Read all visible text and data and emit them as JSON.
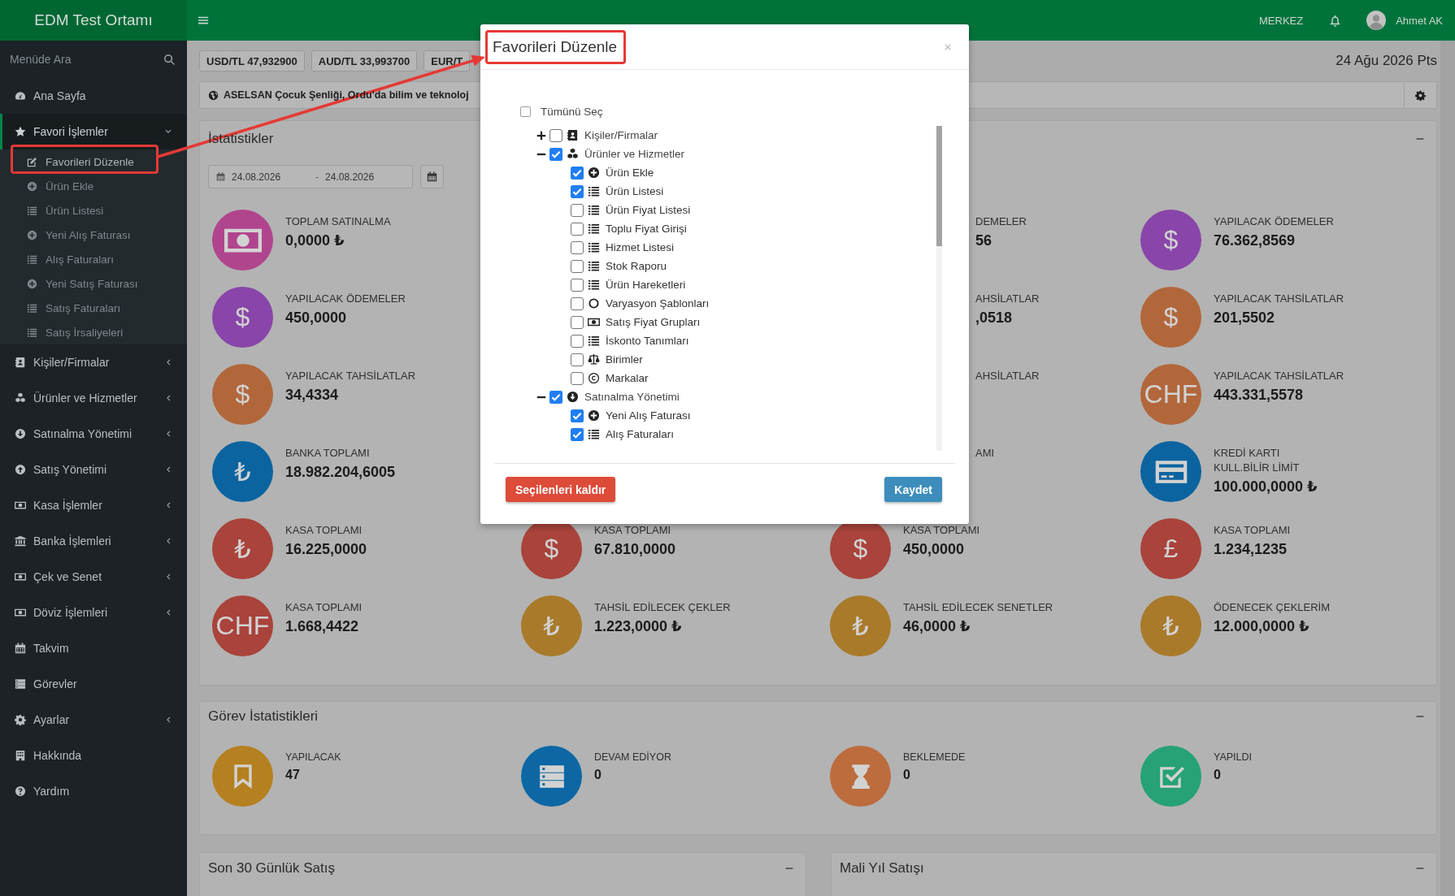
{
  "topbar": {
    "branch": "MERKEZ",
    "user": "Ahmet AK"
  },
  "sidebar": {
    "brand": "EDM Test Ortamı",
    "search": {
      "placeholder": "Menüde Ara"
    },
    "items": [
      {
        "label": "Ana Sayfa",
        "kind": "link",
        "selected": false
      },
      {
        "label": "Favori İşlemler",
        "kind": "group",
        "selected": true,
        "expanded": true,
        "children": [
          {
            "label": "Favorileri Düzenle",
            "selected": true
          },
          {
            "label": "Ürün Ekle",
            "selected": false
          },
          {
            "label": "Ürün Listesi",
            "selected": false
          },
          {
            "label": "Yeni Alış Faturası",
            "selected": false
          },
          {
            "label": "Alış Faturaları",
            "selected": false
          },
          {
            "label": "Yeni Satış Faturası",
            "selected": false
          },
          {
            "label": "Satış Faturaları",
            "selected": false
          },
          {
            "label": "Satış İrsaliyeleri",
            "selected": false
          }
        ]
      },
      {
        "label": "Kişiler/Firmalar",
        "kind": "group",
        "selected": false,
        "expanded": false
      },
      {
        "label": "Ürünler ve Hizmetler",
        "kind": "group",
        "selected": false,
        "expanded": false
      },
      {
        "label": "Satınalma Yönetimi",
        "kind": "group",
        "selected": false,
        "expanded": false
      },
      {
        "label": "Satış Yönetimi",
        "kind": "group",
        "selected": false,
        "expanded": false
      },
      {
        "label": "Kasa İşlemler",
        "kind": "group",
        "selected": false,
        "expanded": false
      },
      {
        "label": "Banka İşlemleri",
        "kind": "group",
        "selected": false,
        "expanded": false
      },
      {
        "label": "Çek ve Senet",
        "kind": "group",
        "selected": false,
        "expanded": false
      },
      {
        "label": "Döviz İşlemleri",
        "kind": "group",
        "selected": false,
        "expanded": false
      },
      {
        "label": "Takvim",
        "kind": "link",
        "selected": false
      },
      {
        "label": "Görevler",
        "kind": "link",
        "selected": false
      },
      {
        "label": "Ayarlar",
        "kind": "group",
        "selected": false,
        "expanded": false
      },
      {
        "label": "Hakkında",
        "kind": "link",
        "selected": false
      },
      {
        "label": "Yardım",
        "kind": "link",
        "selected": false
      }
    ]
  },
  "currency_rates": [
    "USD/TL 47,932900",
    "AUD/TL 33,993700",
    "EUR/T"
  ],
  "date": "24 Ağu 2026 Pts",
  "announcement": "ASELSAN Çocuk Şenliği, Ordu'da bilim ve teknoloj",
  "statistics": {
    "title": "İstatistikler",
    "date_range": {
      "start": "24.08.2026",
      "separator": "-",
      "end": "24.08.2026"
    },
    "columns": [
      [
        {
          "kind": "banknote",
          "color": "#b0458e",
          "label": "TOPLAM SATINALMA",
          "value": "0,0000 ₺"
        },
        {
          "kind": "symbol",
          "symbol": "$",
          "color": "#8945a9",
          "label": "YAPILACAK ÖDEMELER",
          "value": "450,0000"
        },
        {
          "kind": "symbol",
          "symbol": "$",
          "color": "#b2673b",
          "label": "YAPILACAK TAHSİLATLAR",
          "value": "34,4334"
        },
        {
          "kind": "symbol",
          "symbol": "₺",
          "color": "#0b64a0",
          "label": "BANKA TOPLAMI",
          "value": "18.982.204,6005"
        },
        {
          "kind": "symbol",
          "symbol": "₺",
          "color": "#a9433b",
          "label": "KASA TOPLAMI",
          "value": "16.225,0000"
        },
        {
          "kind": "symbol",
          "symbol": "CHF",
          "color": "#a9433b",
          "label": "KASA TOPLAMI",
          "value": "1.668,4422"
        }
      ],
      [
        {
          "kind": "symbol",
          "symbol": "$",
          "color": "#a9433b",
          "label": "KASA TOPLAMI",
          "value": "67.810,0000"
        },
        {
          "kind": "symbol",
          "symbol": "₺",
          "color": "#a97a2a",
          "label": "TAHSİL EDİLECEK ÇEKLER",
          "value": "1.223,0000 ₺"
        }
      ],
      [
        {
          "kind": "covered",
          "label": "DEMELER",
          "value": "56"
        },
        {
          "kind": "covered",
          "label": "AHSİLATLAR",
          "value": ",0518"
        },
        {
          "kind": "covered",
          "label": "AHSİLATLAR"
        },
        {
          "kind": "covered",
          "label": "AMI"
        },
        {
          "kind": "symbol",
          "symbol": "$",
          "color": "#a9433b",
          "label": "KASA TOPLAMI",
          "value": "450,0000"
        },
        {
          "kind": "symbol",
          "symbol": "₺",
          "color": "#a97a2a",
          "label": "TAHSİL EDİLECEK SENETLER",
          "value": "46,0000 ₺"
        }
      ],
      [
        {
          "kind": "symbol",
          "symbol": "$",
          "color": "#8945a9",
          "label": "YAPILACAK ÖDEMELER",
          "value": "76.362,8569"
        },
        {
          "kind": "symbol",
          "symbol": "$",
          "color": "#b2673b",
          "label": "YAPILACAK TAHSİLATLAR",
          "value": "201,5502"
        },
        {
          "kind": "symbol",
          "symbol": "CHF",
          "color": "#b2673b",
          "label": "YAPILACAK TAHSİLATLAR",
          "value": "443.331,5578"
        },
        {
          "kind": "card",
          "color": "#0b64a0",
          "label": "KREDİ KARTI\nKULL.BİLİR LİMİT",
          "value": "100.000,0000 ₺"
        },
        {
          "kind": "symbol",
          "symbol": "£",
          "color": "#a9433b",
          "label": "KASA TOPLAMI",
          "value": "1.234,1235"
        },
        {
          "kind": "symbol",
          "symbol": "₺",
          "color": "#a97a2a",
          "label": "ÖDENECEK ÇEKLERİM",
          "value": "12.000,0000 ₺"
        }
      ]
    ]
  },
  "task_statistics": {
    "title": "Görev İstatistikleri",
    "items": [
      {
        "label": "YAPILACAK",
        "value": "47",
        "color": "#b5801f"
      },
      {
        "label": "DEVAM EDİYOR",
        "value": "0",
        "color": "#0d67a5"
      },
      {
        "label": "BEKLEMEDE",
        "value": "0",
        "color": "#bd6c3e"
      },
      {
        "label": "YAPILDI",
        "value": "0",
        "color": "#26a276"
      }
    ]
  },
  "bottom_panels": [
    {
      "title": "Son 30 Günlük Satış"
    },
    {
      "title": "Mali Yıl Satışı"
    }
  ],
  "modal": {
    "title": "Favorileri Düzenle",
    "select_all": {
      "label": "Tümünü Seç",
      "checked": false
    },
    "tree": [
      {
        "label": "Kişiler/Firmalar",
        "checked": false,
        "expanded": false
      },
      {
        "label": "Ürünler ve Hizmetler",
        "checked": true,
        "expanded": true,
        "children": [
          {
            "label": "Ürün Ekle",
            "checked": true
          },
          {
            "label": "Ürün Listesi",
            "checked": true
          },
          {
            "label": "Ürün Fiyat Listesi",
            "checked": false
          },
          {
            "label": "Toplu Fiyat Girişi",
            "checked": false
          },
          {
            "label": "Hizmet Listesi",
            "checked": false
          },
          {
            "label": "Stok Raporu",
            "checked": false
          },
          {
            "label": "Ürün Hareketleri",
            "checked": false
          },
          {
            "label": "Varyasyon Şablonları",
            "checked": false
          },
          {
            "label": "Satış Fiyat Grupları",
            "checked": false
          },
          {
            "label": "İskonto Tanımları",
            "checked": false
          },
          {
            "label": "Birimler",
            "checked": false
          },
          {
            "label": "Markalar",
            "checked": false
          }
        ]
      },
      {
        "label": "Satınalma Yönetimi",
        "checked": true,
        "expanded": true,
        "children": [
          {
            "label": "Yeni Alış Faturası",
            "checked": true
          },
          {
            "label": "Alış Faturaları",
            "checked": true
          }
        ]
      }
    ],
    "buttons": [
      {
        "label": "Seçilenleri kaldır",
        "kind": "danger"
      },
      {
        "label": "Kaydet",
        "kind": "primary"
      }
    ]
  }
}
